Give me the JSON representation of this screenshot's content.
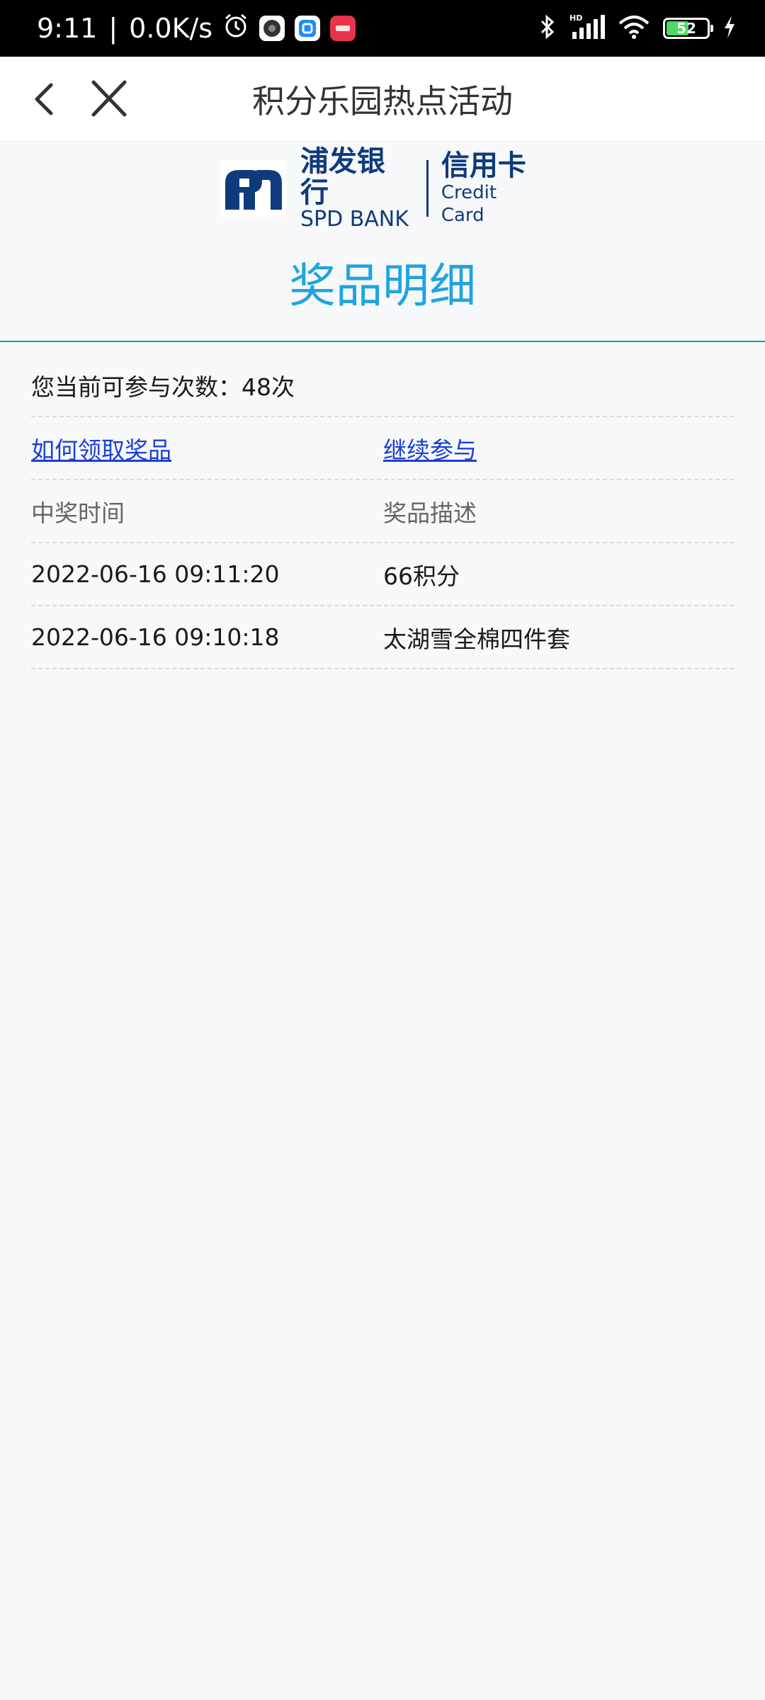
{
  "status_bar": {
    "time": "9:11",
    "net_speed": "0.0K/s",
    "battery_level": "52",
    "icons": [
      "alarm-icon",
      "app-icon-dark",
      "app-icon-blue",
      "app-icon-red",
      "bluetooth-icon",
      "signal-icon",
      "wifi-icon",
      "battery-icon",
      "charging-icon"
    ]
  },
  "nav": {
    "title": "积分乐园热点活动",
    "back_icon": "chevron-left-icon",
    "close_icon": "close-icon"
  },
  "brand": {
    "bank_cn": "浦发银行",
    "bank_en": "SPD BANK",
    "card_cn": "信用卡",
    "card_en": "Credit Card",
    "color": "#0f3b7c"
  },
  "page": {
    "title": "奖品明细",
    "title_color": "#1fa4e0",
    "remaining_label": "您当前可参与次数：48次"
  },
  "actions": {
    "how_to_claim": "如何领取奖品",
    "continue": "继续参与",
    "link_color": "#1a3fd6"
  },
  "table": {
    "headers": [
      "中奖时间",
      "奖品描述"
    ],
    "rows": [
      [
        "2022-06-16 09:11:20",
        "66积分"
      ],
      [
        "2022-06-16 09:10:18",
        "太湖雪全棉四件套"
      ]
    ]
  }
}
